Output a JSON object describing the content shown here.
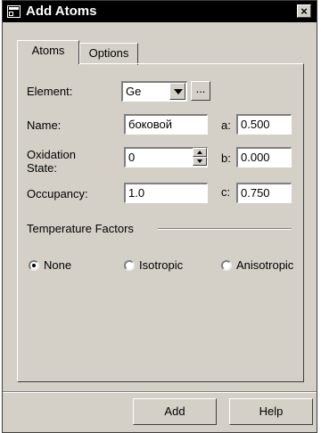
{
  "window": {
    "title": "Add Atoms",
    "close_glyph": "×"
  },
  "tabs": [
    {
      "label": "Atoms",
      "active": true
    },
    {
      "label": "Options",
      "active": false
    }
  ],
  "form": {
    "element_label": "Element:",
    "element_value": "Ge",
    "browse_label": "...",
    "name_label": "Name:",
    "name_value": "боковой",
    "oxidation_label_line1": "Oxidation",
    "oxidation_label_line2": "State:",
    "oxidation_value": "0",
    "occupancy_label": "Occupancy:",
    "occupancy_value": "1.0",
    "a_label": "a:",
    "a_value": "0.500",
    "b_label": "b:",
    "b_value": "0.000",
    "c_label": "c:",
    "c_value": "0.750"
  },
  "temperature": {
    "group_label": "Temperature Factors",
    "options": [
      {
        "label": "None",
        "selected": true
      },
      {
        "label": "Isotropic",
        "selected": false
      },
      {
        "label": "Anisotropic",
        "selected": false
      }
    ]
  },
  "buttons": {
    "add": "Add",
    "help": "Help"
  },
  "icons": {
    "title_icon": "window-icon",
    "dropdown": "chevron-down-icon",
    "spin_up": "arrow-up-icon",
    "spin_down": "arrow-down-icon"
  }
}
